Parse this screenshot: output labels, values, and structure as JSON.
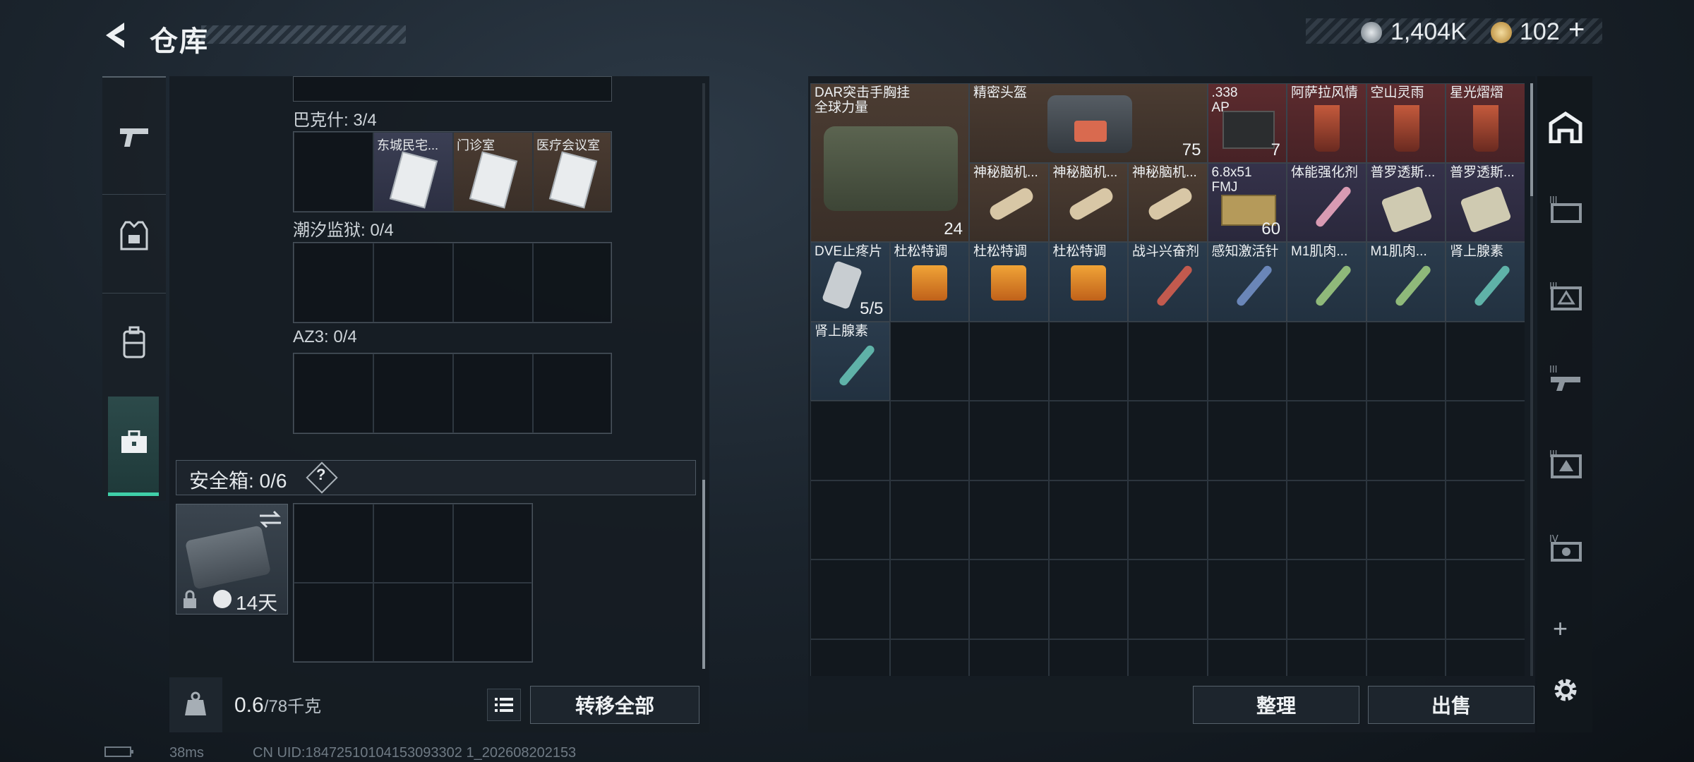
{
  "header": {
    "title": "仓库",
    "currency": {
      "silver": "1,404K",
      "gold": "102",
      "add": "+"
    }
  },
  "left_tabs": [
    {
      "name": "weapons",
      "icon": "pistol-icon"
    },
    {
      "name": "armor",
      "icon": "vest-icon"
    },
    {
      "name": "backpack",
      "icon": "backpack-icon"
    },
    {
      "name": "container",
      "icon": "briefcase-icon",
      "active": true
    }
  ],
  "keycard_sections": [
    {
      "label": "巴克什: 3/4",
      "cards": [
        "东城民宅...",
        "门诊室",
        "医疗会议室"
      ]
    },
    {
      "label": "潮汐监狱: 0/4",
      "cards": []
    },
    {
      "label": "AZ3: 0/4",
      "cards": []
    }
  ],
  "secure_case": {
    "label": "安全箱: 0/6",
    "help": "?",
    "timer": "14天"
  },
  "weight": {
    "current": "0.6",
    "max": "/78千克"
  },
  "buttons": {
    "transfer_all": "转移全部",
    "sort": "整理",
    "sell": "出售"
  },
  "items": [
    {
      "name": "DAR突击手胸挂\n全球力量",
      "qty": "24"
    },
    {
      "name": "精密头盔",
      "qty": "75"
    },
    {
      "name": ".338\nAP",
      "qty": "7"
    },
    {
      "name": "阿萨拉风情",
      "qty": ""
    },
    {
      "name": "空山灵雨",
      "qty": ""
    },
    {
      "name": "星光熠熠",
      "qty": ""
    },
    {
      "name": "神秘脑机...",
      "qty": ""
    },
    {
      "name": "神秘脑机...",
      "qty": ""
    },
    {
      "name": "神秘脑机...",
      "qty": ""
    },
    {
      "name": "6.8x51\nFMJ",
      "qty": "60"
    },
    {
      "name": "体能强化剂",
      "qty": ""
    },
    {
      "name": "普罗透斯...",
      "qty": ""
    },
    {
      "name": "普罗透斯...",
      "qty": ""
    },
    {
      "name": "DVE止疼片",
      "qty": "5/5"
    },
    {
      "name": "杜松特调",
      "qty": ""
    },
    {
      "name": "杜松特调",
      "qty": ""
    },
    {
      "name": "杜松特调",
      "qty": ""
    },
    {
      "name": "战斗兴奋剂",
      "qty": ""
    },
    {
      "name": "感知激活针",
      "qty": ""
    },
    {
      "name": "M1肌肉...",
      "qty": ""
    },
    {
      "name": "M1肌肉...",
      "qty": ""
    },
    {
      "name": "肾上腺素",
      "qty": ""
    },
    {
      "name": "肾上腺素",
      "qty": ""
    }
  ],
  "right_tabs": [
    "home-icon",
    "tier3-case-icon",
    "tier3-box-icon",
    "tier3-rifle-icon",
    "tier3-crate-icon",
    "tier4-case-icon"
  ],
  "status": {
    "ping": "38ms",
    "uid": "CN UID:18472510104153093302 1_202608202153"
  }
}
